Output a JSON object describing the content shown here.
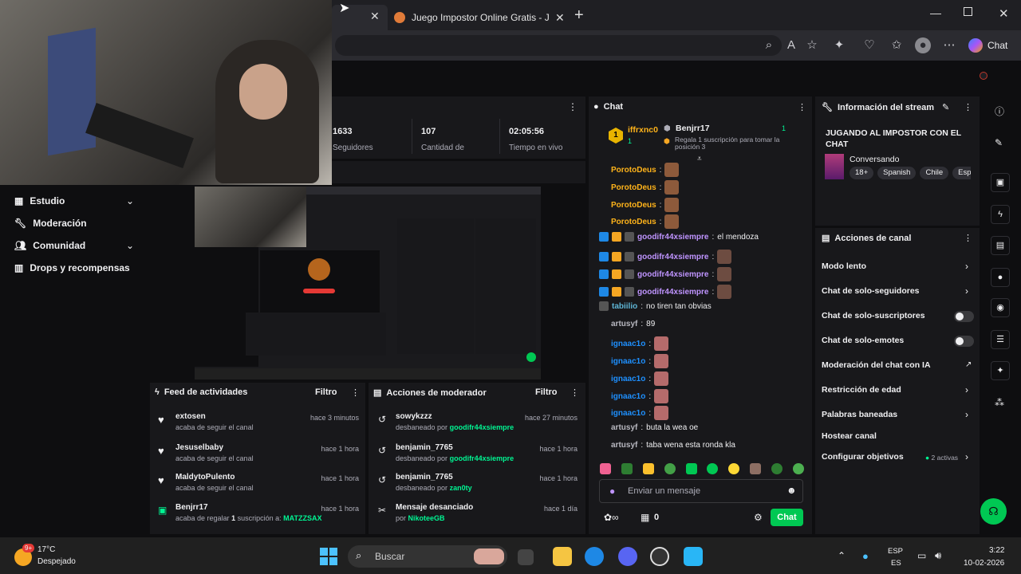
{
  "browser": {
    "tab_title": "Juego Impostor Online Gratis - Jug",
    "chat_button": "Chat"
  },
  "stats": {
    "followers_value": "1633",
    "followers_label": "Seguidores",
    "subs_value": "107",
    "subs_label": "Cantidad de",
    "time_value": "02:05:56",
    "time_label": "Tiempo en vivo"
  },
  "sidebar": {
    "items": [
      {
        "label": "Estudio"
      },
      {
        "label": "Moderación"
      },
      {
        "label": "Comunidad"
      },
      {
        "label": "Drops y recompensas"
      }
    ]
  },
  "activity_feed": {
    "title": "Feed de actividades",
    "filter": "Filtro",
    "items": [
      {
        "name": "extosen",
        "time": "hace 3 minutos",
        "desc": "acaba de seguir el canal"
      },
      {
        "name": "Jesuselbaby",
        "time": "hace 1 hora",
        "desc": "acaba de seguir el canal"
      },
      {
        "name": "MaldytoPulento",
        "time": "hace 1 hora",
        "desc": "acaba de seguir el canal"
      },
      {
        "name": "Benjrr17",
        "time": "hace 1 hora",
        "desc_a": "acaba de regalar",
        "desc_b": "1",
        "desc_c": "suscripción a:",
        "desc_d": "MATZZSAX"
      }
    ]
  },
  "mod_actions": {
    "title": "Acciones de moderador",
    "filter": "Filtro",
    "items": [
      {
        "name": "sowykzzz",
        "time": "hace 27 minutos",
        "desc": "desbaneado por",
        "by": "goodifr44xsiempre"
      },
      {
        "name": "benjamin_7765",
        "time": "hace 1 hora",
        "desc": "desbaneado por",
        "by": "goodifr44xsiempre"
      },
      {
        "name": "benjamin_7765",
        "time": "hace 1 hora",
        "desc": "desbaneado por",
        "by": "zan0ty"
      },
      {
        "name": "Mensaje desanciado",
        "time": "hace 1 día",
        "desc": "por",
        "by": "NikoteeGB"
      }
    ]
  },
  "chat": {
    "title": "Chat",
    "pinned_user": "iffrxnc0",
    "pinned_count": "1",
    "pinned_rank": "1",
    "hype_user": "Benjrr17",
    "hype_count": "1",
    "hype_desc": "Regala 1 suscripción para tomar la posición 3",
    "messages": [
      {
        "user": "PorotoDeus",
        "text": ""
      },
      {
        "user": "PorotoDeus",
        "text": ""
      },
      {
        "user": "PorotoDeus",
        "text": ""
      },
      {
        "user": "PorotoDeus",
        "text": ""
      },
      {
        "user": "goodifr44xsiempre",
        "text": "el mendoza"
      },
      {
        "user": "goodifr44xsiempre",
        "text": ""
      },
      {
        "user": "goodifr44xsiempre",
        "text": ""
      },
      {
        "user": "goodifr44xsiempre",
        "text": ""
      },
      {
        "user": "tabiilio",
        "text": "no tiren tan obvias"
      },
      {
        "user": "artusyf",
        "text": "89"
      },
      {
        "user": "ignaac1o",
        "text": ""
      },
      {
        "user": "ignaac1o",
        "text": ""
      },
      {
        "user": "ignaac1o",
        "text": ""
      },
      {
        "user": "ignaac1o",
        "text": ""
      },
      {
        "user": "ignaac1o",
        "text": ""
      },
      {
        "user": "artusyf",
        "text": "buta la wea oe"
      },
      {
        "user": "artusyf",
        "text": "taba wena esta ronda kla"
      }
    ],
    "input_placeholder": "Enviar un mensaje",
    "points": "0",
    "send_label": "Chat"
  },
  "stream_info": {
    "title": "Información del stream",
    "stream_title": "JUGANDO AL IMPOSTOR CON EL CHAT",
    "category": "Conversando",
    "tags": [
      "18+",
      "Spanish",
      "Chile",
      "Espa"
    ]
  },
  "channel_actions": {
    "title": "Acciones de canal",
    "items": [
      {
        "label": "Modo lento"
      },
      {
        "label": "Chat de solo-seguidores"
      },
      {
        "label": "Chat de solo-suscriptores"
      },
      {
        "label": "Chat de solo-emotes"
      },
      {
        "label": "Moderación del chat con IA"
      },
      {
        "label": "Restricción de edad"
      },
      {
        "label": "Palabras baneadas"
      },
      {
        "label": "Hostear canal"
      },
      {
        "label": "Configurar objetivos"
      }
    ],
    "goals_active": "2 activas"
  },
  "taskbar": {
    "weather_temp": "17°C",
    "weather_desc": "Despejado",
    "weather_badge": "9+",
    "search_placeholder": "Buscar",
    "lang_top": "ESP",
    "lang_bottom": "ES",
    "time": "3:22",
    "date": "10-02-2026"
  },
  "colors": {
    "accent_green": "#00f593",
    "accent_purple": "#bf94ff",
    "panel_bg": "#18181b",
    "page_bg": "#0e0e10"
  }
}
